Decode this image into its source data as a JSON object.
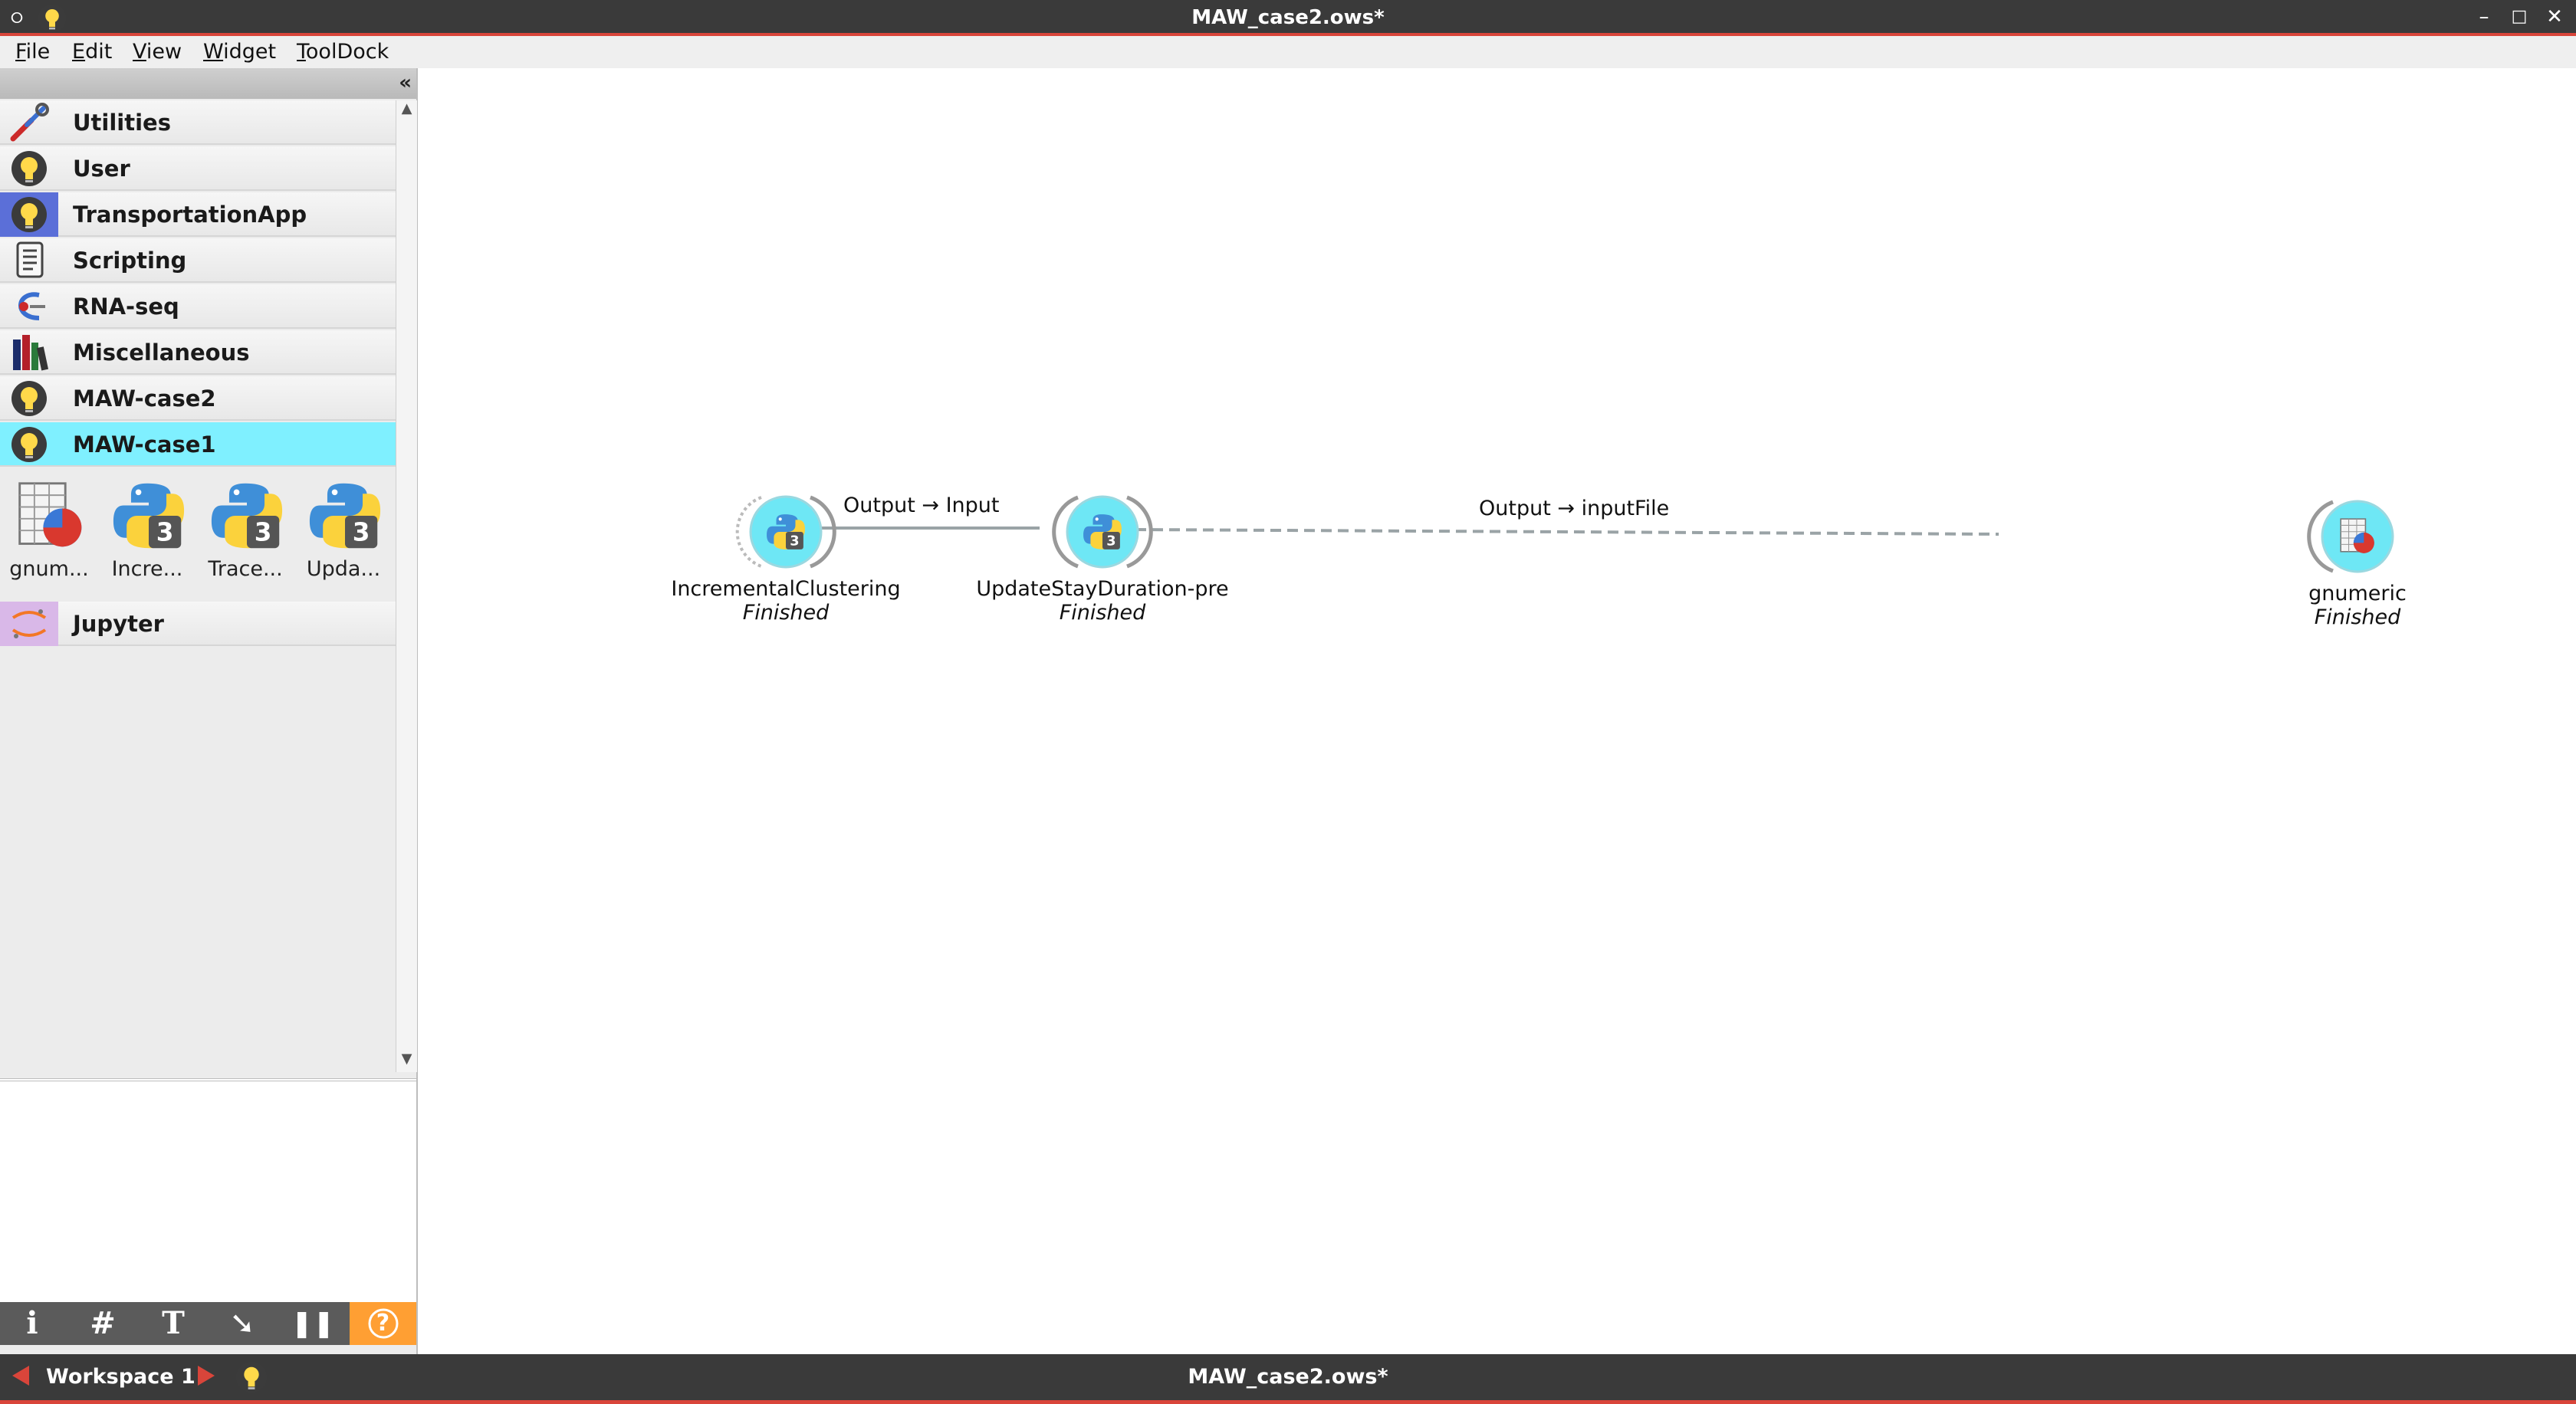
{
  "window": {
    "title": "MAW_case2.ows*",
    "controls": {
      "minimize": "–",
      "maximize": "□",
      "close": "✕"
    }
  },
  "menu": [
    {
      "key": "F",
      "rest": "ile"
    },
    {
      "key": "E",
      "rest": "dit"
    },
    {
      "key": "V",
      "rest": "iew"
    },
    {
      "key": "W",
      "rest": "idget"
    },
    {
      "key": "T",
      "rest": "oolDock"
    }
  ],
  "dock": {
    "collapse_label": "«",
    "categories": [
      {
        "label": "Utilities",
        "icon": "tools-icon"
      },
      {
        "label": "User",
        "icon": "bulb-icon"
      },
      {
        "label": "TransportationApp",
        "icon": "bulb-icon"
      },
      {
        "label": "Scripting",
        "icon": "script-icon"
      },
      {
        "label": "RNA-seq",
        "icon": "rna-icon"
      },
      {
        "label": "Miscellaneous",
        "icon": "books-icon"
      },
      {
        "label": "MAW-case2",
        "icon": "bulb-icon"
      },
      {
        "label": "MAW-case1",
        "icon": "bulb-icon",
        "active": true
      },
      {
        "label": "Jupyter",
        "icon": "jupyter-icon"
      }
    ],
    "widgets": [
      {
        "label": "gnum...",
        "icon": "spreadsheet-icon"
      },
      {
        "label": "Incre...",
        "icon": "python-icon"
      },
      {
        "label": "Trace...",
        "icon": "python-icon"
      },
      {
        "label": "Upda...",
        "icon": "python-icon"
      }
    ],
    "toolbar": {
      "info": "i",
      "grid": "#",
      "text": "T",
      "arrow": "➘",
      "pause": "❚❚",
      "help": "?"
    }
  },
  "canvas": {
    "nodes": [
      {
        "title": "IncrementalClustering",
        "state": "Finished",
        "icon": "python-icon"
      },
      {
        "title": "UpdateStayDuration-pre",
        "state": "Finished",
        "icon": "python-icon"
      },
      {
        "title": "gnumeric",
        "state": "Finished",
        "icon": "spreadsheet-icon"
      }
    ],
    "links": [
      {
        "label": "Output → Input"
      },
      {
        "label": "Output → inputFile"
      }
    ]
  },
  "status": {
    "workspace": "Workspace 1",
    "title": "MAW_case2.ows*"
  },
  "colors": {
    "titlebar": "#3a3a3a",
    "accent_red": "#d9453a",
    "active_category": "#7ff0ff",
    "help_button": "#ff9f33",
    "node_fill": "#6ee7f5"
  }
}
